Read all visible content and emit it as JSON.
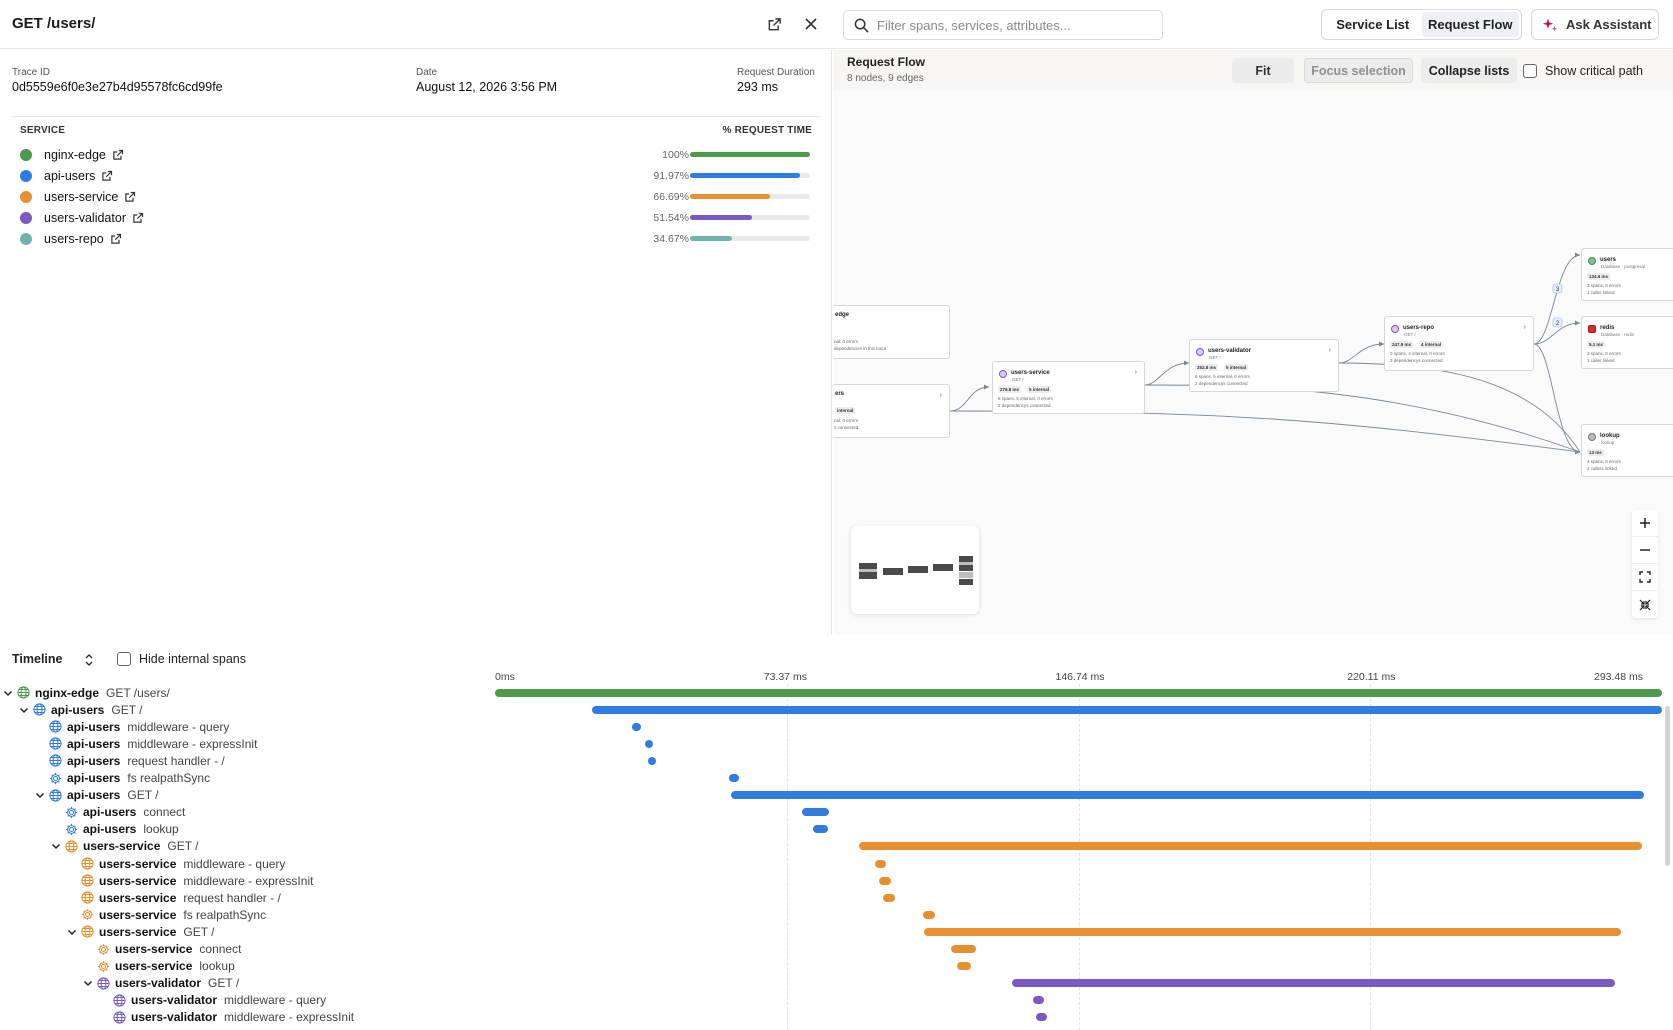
{
  "header": {
    "title": "GET /users/",
    "search_placeholder": "Filter spans, services, attributes...",
    "view_tabs": [
      "Service List",
      "Request Flow"
    ],
    "active_tab": "Request Flow",
    "assistant_label": "Ask Assistant"
  },
  "trace": {
    "id_label": "Trace ID",
    "id": "0d5559e6f0e3e27b4d95578fc6cd99fe",
    "date_label": "Date",
    "date": "August 12, 2026 3:56 PM",
    "duration_label": "Request Duration",
    "duration": "293 ms"
  },
  "services": {
    "col_service": "SERVICE",
    "col_time": "% REQUEST TIME",
    "rows": [
      {
        "name": "nginx-edge",
        "pct": "100%",
        "value": 100,
        "color": "#4d9a4d"
      },
      {
        "name": "api-users",
        "pct": "91.97%",
        "value": 91.97,
        "color": "#2f7de1"
      },
      {
        "name": "users-service",
        "pct": "66.69%",
        "value": 66.69,
        "color": "#e8902f"
      },
      {
        "name": "users-validator",
        "pct": "51.54%",
        "value": 51.54,
        "color": "#7a5bc4"
      },
      {
        "name": "users-repo",
        "pct": "34.67%",
        "value": 34.67,
        "color": "#6fb4ac"
      }
    ]
  },
  "flow": {
    "title": "Request Flow",
    "subtitle": "8 nodes, 9 edges",
    "fit_label": "Fit",
    "focus_label": "Focus selection",
    "collapse_label": "Collapse lists",
    "critical_label": "Show critical path",
    "nodes": {
      "edge": {
        "title": "edge",
        "l1": "nal, 0 errors",
        "l2": "dependencies in this trace"
      },
      "ers": {
        "title": "ers",
        "badge": "internal",
        "l1": "nal, 0 errors",
        "l2": "s connected"
      },
      "svc": {
        "title": "users-service",
        "sub": "GET /",
        "b1": "276.8 ms",
        "b2": "5 internal",
        "l1": "6 spans, 5 internal, 0 errors",
        "l2": "2 dependencys connected"
      },
      "val": {
        "title": "users-validator",
        "sub": "GET /",
        "b1": "252.8 ms",
        "b2": "5 internal",
        "l1": "6 spans, 5 internal, 0 errors",
        "l2": "2 dependencys connected"
      },
      "repo": {
        "title": "users-repo",
        "sub": "GET /",
        "b1": "247.9 ms",
        "b2": "4 internal",
        "l1": "0 spans, 4 internal, 0 errors",
        "l2": "3 dependencys connected"
      },
      "users": {
        "title": "users",
        "sub": "Database - postgresql",
        "b1": "134.6 ms",
        "l1": "3 spans, 0 errors",
        "l2": "1 caller linked"
      },
      "redis": {
        "title": "redis",
        "sub": "Database - redis",
        "b1": "5.1 ms",
        "l1": "3 spans, 0 errors",
        "l2": "1 caller linked"
      },
      "lookup": {
        "title": "lookup",
        "sub": "lookup",
        "b1": "13 ms",
        "l1": "4 spans, 0 errors",
        "l2": "4 callers linked"
      }
    },
    "edge_counts": [
      "3",
      "2"
    ]
  },
  "timeline": {
    "title": "Timeline",
    "hide_label": "Hide internal spans",
    "ticks": [
      "0ms",
      "73.37 ms",
      "146.74 ms",
      "220.11 ms",
      "293.48 ms"
    ],
    "total_ms": 293.48,
    "spans": [
      {
        "depth": 0,
        "caret": true,
        "icon": "globe",
        "service": "nginx-edge",
        "op": "GET /users/",
        "color": "#4d9a4d",
        "start": 0,
        "end": 293.48
      },
      {
        "depth": 1,
        "caret": true,
        "icon": "globe",
        "service": "api-users",
        "op": "GET /",
        "color": "#2f7de1",
        "start": 24.3,
        "end": 293.48
      },
      {
        "depth": 2,
        "caret": false,
        "icon": "globe",
        "service": "api-users",
        "op": "middleware - query",
        "color": "#2f7de1",
        "start": 34.5,
        "end": 36.6
      },
      {
        "depth": 2,
        "caret": false,
        "icon": "globe",
        "service": "api-users",
        "op": "middleware - expressInit",
        "color": "#2f7de1",
        "start": 37.6,
        "end": 39.5
      },
      {
        "depth": 2,
        "caret": false,
        "icon": "globe",
        "service": "api-users",
        "op": "request handler - /",
        "color": "#2f7de1",
        "start": 38.5,
        "end": 40.5
      },
      {
        "depth": 2,
        "caret": false,
        "icon": "gear",
        "service": "api-users",
        "op": "fs realpathSync",
        "color": "#2f7de1",
        "start": 58.8,
        "end": 61.4
      },
      {
        "depth": 2,
        "caret": true,
        "icon": "globe",
        "service": "api-users",
        "op": "GET /",
        "color": "#2f7de1",
        "start": 59.4,
        "end": 289.0
      },
      {
        "depth": 3,
        "caret": false,
        "icon": "gear",
        "service": "api-users",
        "op": "connect",
        "color": "#2f7de1",
        "start": 77.1,
        "end": 84.0
      },
      {
        "depth": 3,
        "caret": false,
        "icon": "gear",
        "service": "api-users",
        "op": "lookup",
        "color": "#2f7de1",
        "start": 80.0,
        "end": 83.7
      },
      {
        "depth": 3,
        "caret": true,
        "icon": "globe",
        "service": "users-service",
        "op": "GET /",
        "color": "#e8902f",
        "start": 91.6,
        "end": 288.4
      },
      {
        "depth": 4,
        "caret": false,
        "icon": "globe",
        "service": "users-service",
        "op": "middleware - query",
        "color": "#e8902f",
        "start": 95.5,
        "end": 98.4
      },
      {
        "depth": 4,
        "caret": false,
        "icon": "globe",
        "service": "users-service",
        "op": "middleware - expressInit",
        "color": "#e8902f",
        "start": 96.6,
        "end": 99.5
      },
      {
        "depth": 4,
        "caret": false,
        "icon": "globe",
        "service": "users-service",
        "op": "request handler - /",
        "color": "#e8902f",
        "start": 97.7,
        "end": 100.6
      },
      {
        "depth": 4,
        "caret": false,
        "icon": "gear",
        "service": "users-service",
        "op": "fs realpathSync",
        "color": "#e8902f",
        "start": 107.7,
        "end": 110.6
      },
      {
        "depth": 4,
        "caret": true,
        "icon": "globe",
        "service": "users-service",
        "op": "GET /",
        "color": "#e8902f",
        "start": 107.9,
        "end": 283.1
      },
      {
        "depth": 5,
        "caret": false,
        "icon": "gear",
        "service": "users-service",
        "op": "connect",
        "color": "#e8902f",
        "start": 114.8,
        "end": 120.9
      },
      {
        "depth": 5,
        "caret": false,
        "icon": "gear",
        "service": "users-service",
        "op": "lookup",
        "color": "#e8902f",
        "start": 116.2,
        "end": 119.8
      },
      {
        "depth": 5,
        "caret": true,
        "icon": "globe",
        "service": "users-validator",
        "op": "GET /",
        "color": "#7a5bc4",
        "start": 130.1,
        "end": 281.6
      },
      {
        "depth": 6,
        "caret": false,
        "icon": "globe",
        "service": "users-validator",
        "op": "middleware - query",
        "color": "#7a5bc4",
        "start": 135.2,
        "end": 138.1
      },
      {
        "depth": 6,
        "caret": false,
        "icon": "globe",
        "service": "users-validator",
        "op": "middleware - expressInit",
        "color": "#7a5bc4",
        "start": 136.0,
        "end": 138.9
      }
    ]
  }
}
